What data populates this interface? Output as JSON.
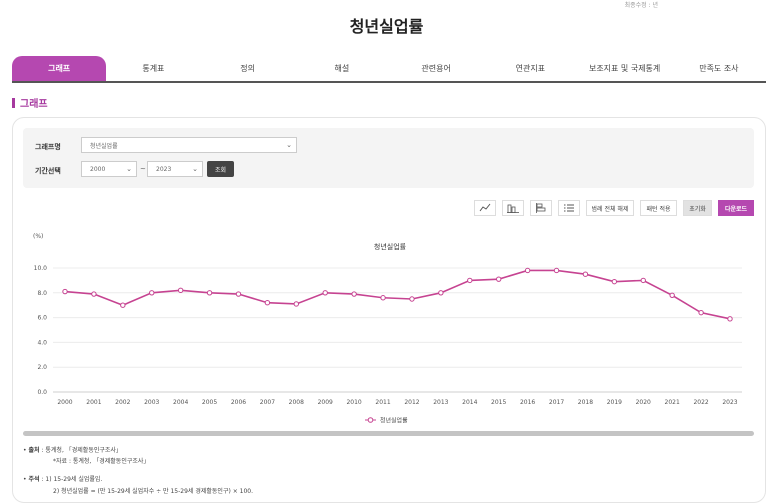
{
  "header": {
    "top_note": "최종수정 : 년",
    "title": "청년실업률"
  },
  "tabs": [
    {
      "label": "그래프",
      "active": true
    },
    {
      "label": "통계표"
    },
    {
      "label": "정의"
    },
    {
      "label": "해설"
    },
    {
      "label": "관련용어"
    },
    {
      "label": "연관지표"
    },
    {
      "label": "보조지표 및 국제통계"
    },
    {
      "label": "만족도 조사"
    }
  ],
  "section": {
    "title": "그래프"
  },
  "filters": {
    "graph_label": "그래프명",
    "graph_value": "청년실업률",
    "period_label": "기간선택",
    "start_year": "2000",
    "tilde": "~",
    "end_year": "2023",
    "search_button": "조회"
  },
  "toolbar": {
    "legend_toggle": "범례 전체 해제",
    "pattern": "패턴 적용",
    "reset": "초기화",
    "download": "다운로드"
  },
  "chart_data": {
    "type": "line",
    "title": "청년실업률",
    "unit_label": "(%)",
    "x": [
      "2000",
      "2001",
      "2002",
      "2003",
      "2004",
      "2005",
      "2006",
      "2007",
      "2008",
      "2009",
      "2010",
      "2011",
      "2012",
      "2013",
      "2014",
      "2015",
      "2016",
      "2017",
      "2018",
      "2019",
      "2020",
      "2021",
      "2022",
      "2023"
    ],
    "series": [
      {
        "name": "청년실업률",
        "color": "#c64391",
        "values": [
          8.1,
          7.9,
          7.0,
          8.0,
          8.2,
          8.0,
          7.9,
          7.2,
          7.1,
          8.0,
          7.9,
          7.6,
          7.5,
          8.0,
          9.0,
          9.1,
          9.8,
          9.8,
          9.5,
          8.9,
          9.0,
          7.8,
          6.4,
          5.9
        ]
      }
    ],
    "yticks": [
      "0.0",
      "2.0",
      "4.0",
      "6.0",
      "8.0",
      "10.0"
    ],
    "ylim": [
      0,
      10
    ],
    "grid": true,
    "legend": "bottom-center"
  },
  "notes": {
    "source_label": "출처",
    "source_text": "통계청, 「경제활동인구조사」",
    "source_sub": "*자료 : 통계청, 「경제활동인구조사」",
    "remark_label": "주석",
    "remark_1": "1) 15-29세 실업률임.",
    "remark_2": "2) 청년실업률 = (만 15-29세 실업자수 ÷ 만 15-29세 경제활동인구) × 100."
  }
}
